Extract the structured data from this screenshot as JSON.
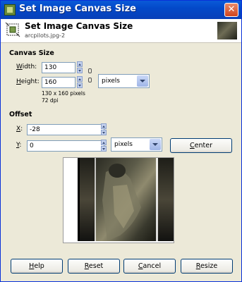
{
  "window": {
    "title": "Set Image Canvas Size",
    "close_glyph": "✕"
  },
  "header": {
    "title": "Set Image Canvas Size",
    "subtitle": "arcpilots.jpg-2"
  },
  "canvas_size": {
    "section_label": "Canvas Size",
    "width_label_first": "W",
    "width_label_rest": "idth:",
    "width_value": "130",
    "height_label_first": "H",
    "height_label_rest": "eight:",
    "height_value": "160",
    "unit": "pixels",
    "info_pixels": "130 x 160 pixels",
    "info_dpi": "72 dpi"
  },
  "offset": {
    "section_label": "Offset",
    "x_label_first": "X",
    "x_label_rest": ":",
    "x_value": "-28",
    "y_label_first": "Y",
    "y_label_rest": ":",
    "y_value": "0",
    "unit": "pixels",
    "center_first": "C",
    "center_rest": "enter"
  },
  "buttons": {
    "help_first": "H",
    "help_rest": "elp",
    "reset_first": "R",
    "reset_rest": "eset",
    "cancel_first": "C",
    "cancel_rest": "ancel",
    "resize_first": "R",
    "resize_rest": "esize"
  },
  "colors": {
    "title_bar": "#0349c9",
    "dialog_bg": "#ece9d8",
    "accent_border": "#003c74"
  },
  "icons": [
    "gimp-icon",
    "close-icon",
    "canvas-size-icon",
    "chain-link-icon",
    "spin-up-icon",
    "spin-down-icon",
    "dropdown-arrow-icon"
  ]
}
